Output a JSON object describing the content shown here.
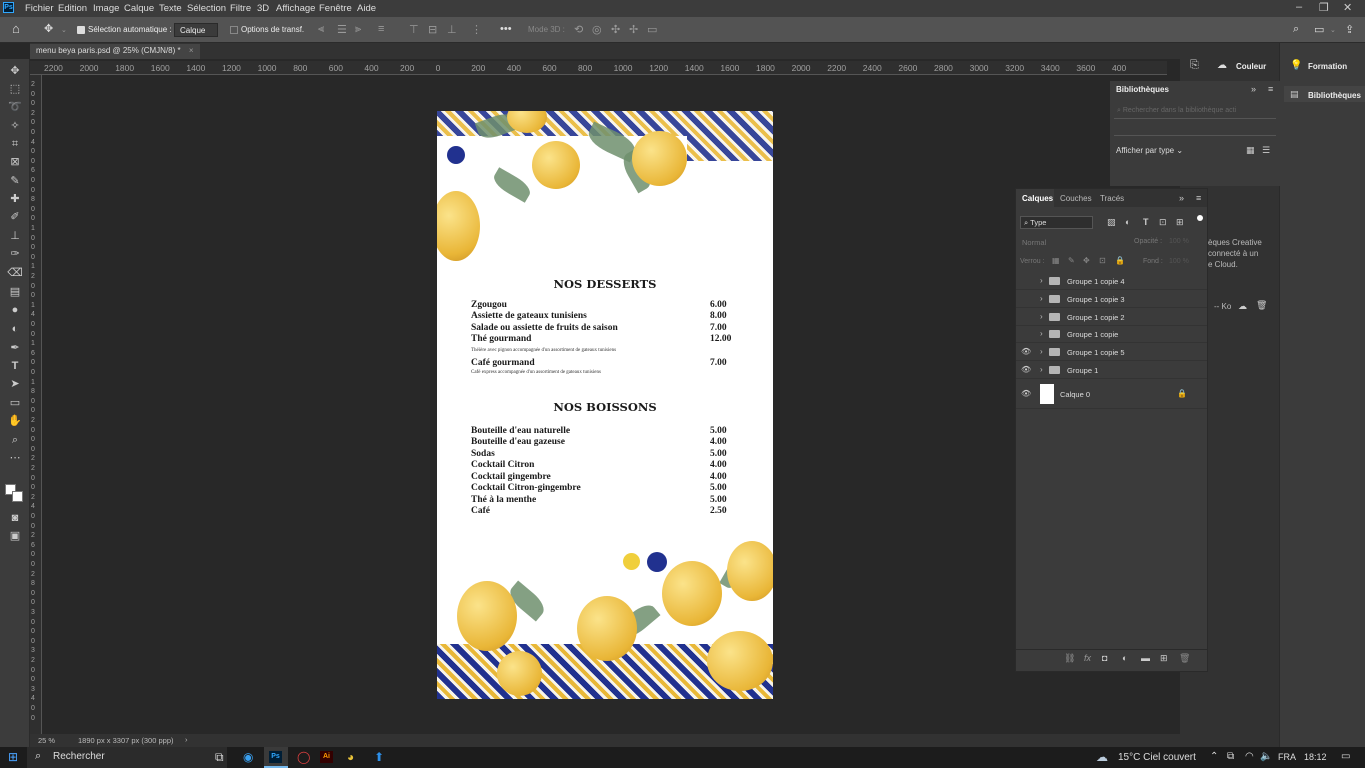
{
  "app": {
    "logo": "Ps",
    "menus": [
      "Fichier",
      "Edition",
      "Image",
      "Calque",
      "Texte",
      "Sélection",
      "Filtre",
      "3D",
      "Affichage",
      "Fenêtre",
      "Aide"
    ],
    "window_controls": [
      "–",
      "❐",
      "✕"
    ]
  },
  "options": {
    "auto_select_label": "Sélection automatique :",
    "auto_select_value": "Calque",
    "transform_label": "Options de transf.",
    "mode3d_label": "Mode 3D :"
  },
  "document": {
    "tab_title": "menu beya paris.psd @ 25% (CMJN/8) *",
    "zoom": "25 %",
    "doc_info": "1890 px x 3307 px (300 ppp)"
  },
  "ruler": {
    "top": [
      "2200",
      "2000",
      "1800",
      "1600",
      "1400",
      "1200",
      "1000",
      "800",
      "600",
      "400",
      "200",
      "0",
      "200",
      "400",
      "600",
      "800",
      "1000",
      "1200",
      "1400",
      "1600",
      "1800",
      "2000",
      "2200",
      "2400",
      "2600",
      "2800",
      "3000",
      "3200",
      "3400",
      "3600",
      "400"
    ],
    "left": [
      "2",
      "0",
      "0",
      "2",
      "0",
      "0",
      "4",
      "0",
      "0",
      "6",
      "0",
      "0",
      "8",
      "0",
      "0",
      "1",
      "0",
      "0",
      "0",
      "1",
      "2",
      "0",
      "0",
      "1",
      "4",
      "0",
      "0",
      "1",
      "6",
      "0",
      "0",
      "1",
      "8",
      "0",
      "0",
      "2",
      "0",
      "0",
      "0",
      "2",
      "2",
      "0",
      "0",
      "2",
      "4",
      "0",
      "0",
      "2",
      "6",
      "0",
      "0",
      "2",
      "8",
      "0",
      "0",
      "3",
      "0",
      "0",
      "0",
      "3",
      "2",
      "0",
      "0",
      "3",
      "4",
      "0",
      "0"
    ]
  },
  "menu_card": {
    "desserts_title": "NOS DESSERTS",
    "desserts": [
      {
        "name": "Zgougou",
        "price": "6.00"
      },
      {
        "name": "Assiette de gateaux tunisiens",
        "price": "8.00"
      },
      {
        "name": "Salade ou assiette de fruits de saison",
        "price": "7.00"
      },
      {
        "name": "Thé gourmand",
        "price": "12.00",
        "note": "Théière avec pignon accompagnée d'un assortiment de gateaux tunisiens"
      },
      {
        "name": "Café gourmand",
        "price": "7.00",
        "note": "Café express accompagnée d'un assortiment de gateaux tunisiens"
      }
    ],
    "boissons_title": "NOS BOISSONS",
    "boissons": [
      {
        "name": "Bouteille d'eau naturelle",
        "price": "5.00"
      },
      {
        "name": "Bouteille d'eau gazeuse",
        "price": "4.00"
      },
      {
        "name": "Sodas",
        "price": "5.00"
      },
      {
        "name": "Cocktail Citron",
        "price": "4.00"
      },
      {
        "name": "Cocktail gingembre",
        "price": "4.00"
      },
      {
        "name": "Cocktail Citron-gingembre",
        "price": "5.00"
      },
      {
        "name": "Thé à la menthe",
        "price": "5.00"
      },
      {
        "name": "Café",
        "price": "2.50"
      }
    ]
  },
  "right_panels": {
    "couleur": "Couleur",
    "formation": "Formation",
    "bibliotheques_tab": "Bibliothèques",
    "bibliotheques_side": "Bibliothèques",
    "lib_search_placeholder": "Rechercher dans la bibliothèque acti",
    "afficher_par_type": "Afficher par type",
    "cc_text_1": "èques Creative",
    "cc_text_2": "connecté à un",
    "cc_text_3": "e Cloud.",
    "ko_label": "-- Ko"
  },
  "layers_panel": {
    "tabs": [
      "Calques",
      "Couches",
      "Tracés"
    ],
    "filter_type": "Type",
    "blend_mode": "Normal",
    "opacity_label": "Opacité :",
    "opacity_value": "100 %",
    "lock_label": "Verrou :",
    "fill_label": "Fond :",
    "fill_value": "100 %",
    "layers": [
      {
        "name": "Groupe 1 copie 4",
        "visible": false,
        "type": "group"
      },
      {
        "name": "Groupe 1 copie 3",
        "visible": false,
        "type": "group"
      },
      {
        "name": "Groupe 1 copie 2",
        "visible": false,
        "type": "group"
      },
      {
        "name": "Groupe 1 copie",
        "visible": false,
        "type": "group"
      },
      {
        "name": "Groupe 1 copie 5",
        "visible": true,
        "type": "group"
      },
      {
        "name": "Groupe 1",
        "visible": true,
        "type": "group"
      },
      {
        "name": "Calque 0",
        "visible": true,
        "type": "layer",
        "locked": true
      }
    ]
  },
  "taskbar": {
    "search": "Rechercher",
    "weather": "15°C  Ciel couvert",
    "lang": "FRA",
    "time": "18:12"
  },
  "colors": {
    "accent": "#31a8ff",
    "tile_blue": "#21318f",
    "lemon": "#e9b637"
  }
}
